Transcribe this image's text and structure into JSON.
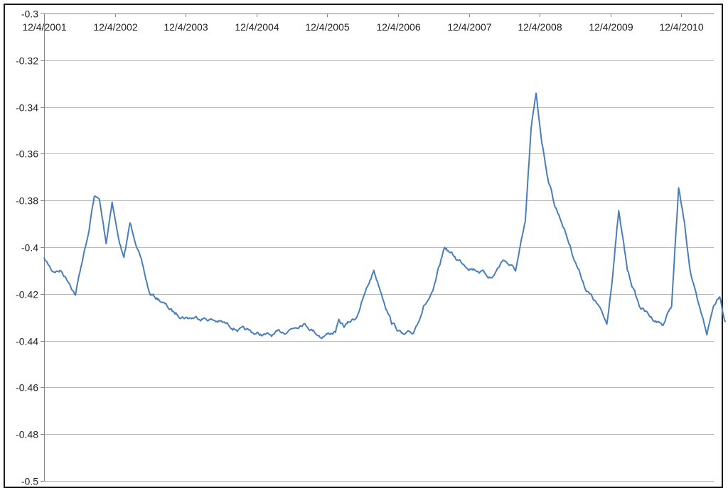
{
  "chart_data": {
    "type": "line",
    "title": "",
    "xlabel": "",
    "ylabel": "",
    "ylim": [
      -0.5,
      -0.3
    ],
    "yticks": [
      -0.3,
      -0.32,
      -0.34,
      -0.36,
      -0.38,
      -0.4,
      -0.42,
      -0.44,
      -0.46,
      -0.48,
      -0.5
    ],
    "ytick_labels": [
      "-0.3",
      "-0.32",
      "-0.34",
      "-0.36",
      "-0.38",
      "-0.4",
      "-0.42",
      "-0.44",
      "-0.46",
      "-0.48",
      "-0.5"
    ],
    "xticks": [
      "12/4/2001",
      "12/4/2002",
      "12/4/2003",
      "12/4/2004",
      "12/4/2005",
      "12/4/2006",
      "12/4/2007",
      "12/4/2008",
      "12/4/2009",
      "12/4/2010"
    ],
    "x_axis_position": "top",
    "grid": true,
    "legend": "none",
    "series": [
      {
        "color": "#4a7ebb",
        "x": [
          "2001-12-04",
          "2002-01-15",
          "2002-03-01",
          "2002-04-15",
          "2002-05-15",
          "2002-06-20",
          "2002-07-20",
          "2002-08-20",
          "2002-09-15",
          "2002-10-20",
          "2002-11-20",
          "2002-12-20",
          "2003-01-20",
          "2003-02-20",
          "2003-04-01",
          "2003-06-01",
          "2003-08-01",
          "2003-10-01",
          "2003-12-15",
          "2004-03-01",
          "2004-06-01",
          "2004-09-01",
          "2004-12-01",
          "2005-02-15",
          "2005-05-01",
          "2005-08-01",
          "2005-11-01",
          "2006-01-15",
          "2006-02-01",
          "2006-03-01",
          "2006-05-01",
          "2006-08-01",
          "2006-11-01",
          "2007-01-01",
          "2007-02-20",
          "2007-04-15",
          "2007-06-01",
          "2007-08-01",
          "2007-10-01",
          "2007-12-01",
          "2008-02-01",
          "2008-04-01",
          "2008-06-01",
          "2008-08-01",
          "2008-09-20",
          "2008-10-20",
          "2008-11-15",
          "2008-12-15",
          "2009-01-15",
          "2009-02-20",
          "2009-04-01",
          "2009-06-01",
          "2009-08-01",
          "2009-10-01",
          "2009-11-15",
          "2009-12-10",
          "2010-01-15",
          "2010-03-01",
          "2010-05-01",
          "2010-07-01",
          "2010-09-01",
          "2010-10-15",
          "2010-11-20",
          "2010-12-20",
          "2011-01-20",
          "2011-03-01",
          "2011-04-15",
          "2011-05-20",
          "2011-06-20",
          "2011-07-20"
        ],
        "values": [
          -0.405,
          -0.41,
          -0.41,
          -0.415,
          -0.42,
          -0.405,
          -0.395,
          -0.378,
          -0.38,
          -0.398,
          -0.38,
          -0.395,
          -0.405,
          -0.39,
          -0.4,
          -0.42,
          -0.423,
          -0.428,
          -0.43,
          -0.43,
          -0.432,
          -0.435,
          -0.437,
          -0.438,
          -0.436,
          -0.432,
          -0.438,
          -0.436,
          -0.432,
          -0.434,
          -0.43,
          -0.41,
          -0.432,
          -0.438,
          -0.437,
          -0.425,
          -0.42,
          -0.4,
          -0.405,
          -0.408,
          -0.41,
          -0.413,
          -0.405,
          -0.41,
          -0.39,
          -0.35,
          -0.335,
          -0.355,
          -0.37,
          -0.382,
          -0.39,
          -0.405,
          -0.418,
          -0.425,
          -0.433,
          -0.415,
          -0.385,
          -0.41,
          -0.425,
          -0.43,
          -0.433,
          -0.425,
          -0.375,
          -0.39,
          -0.41,
          -0.425,
          -0.437,
          -0.425,
          -0.42,
          -0.432
        ]
      }
    ]
  }
}
